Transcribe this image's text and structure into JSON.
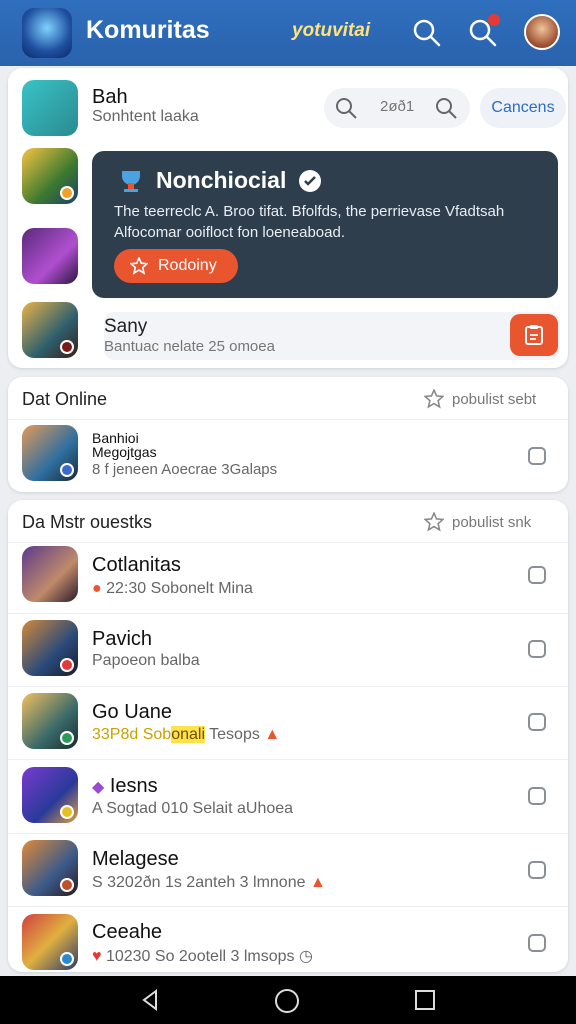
{
  "header": {
    "title": "Komuritas",
    "brand": "yotuvitai",
    "icons": [
      "search-icon",
      "notification-icon",
      "profile-avatar"
    ]
  },
  "top_card": {
    "profile": {
      "name": "Bah",
      "subtitle": "Sonhtent laaka"
    },
    "search_value": "2øð1",
    "cancel_label": "Cancens",
    "feature": {
      "title": "Nonchiocial",
      "description": "The teerreclc A. Broo tifat. Bfolfds, the perrievase Vfadtsah Alfocomar ooifloct fon loeneaboad.",
      "button_label": "Rodoiny"
    },
    "input": {
      "title": "Sany",
      "subtitle": "Bantuac nelate 25 omoea"
    }
  },
  "online_section": {
    "title": "Dat Online",
    "right_label": "pobulist  sebt",
    "item": {
      "name_line1": "Banhioi",
      "name_line2": "Megojtgas",
      "detail": "8 f jeneen Aoecrae 3Galaps"
    }
  },
  "list_section": {
    "title": "Da Mstr ouestks",
    "right_label": "pobulist  snk",
    "items": [
      {
        "name": "Cotlanitas",
        "detail": "22:30  Sobonelt Mina"
      },
      {
        "name": "Pavich",
        "detail": "Papoeon balba"
      },
      {
        "name": "Go Uane",
        "detail_prefix": "33P8d Sob",
        "detail_highlight": "onali",
        "detail_suffix": " Tesops"
      },
      {
        "name": "Iesns",
        "detail": "A Sogtad 010 Selait aUhoea"
      },
      {
        "name": "Melagese",
        "detail": "S 3202ðn 1s 2anteh 3 lmnone"
      },
      {
        "name": "Ceeahe",
        "detail": "10230  So 2ootell 3 lmsops"
      }
    ]
  },
  "colors": {
    "header": "#2f6fbd",
    "accent": "#e8552f",
    "feature_bg": "#2f3e4d",
    "link": "#2b6cc4"
  }
}
